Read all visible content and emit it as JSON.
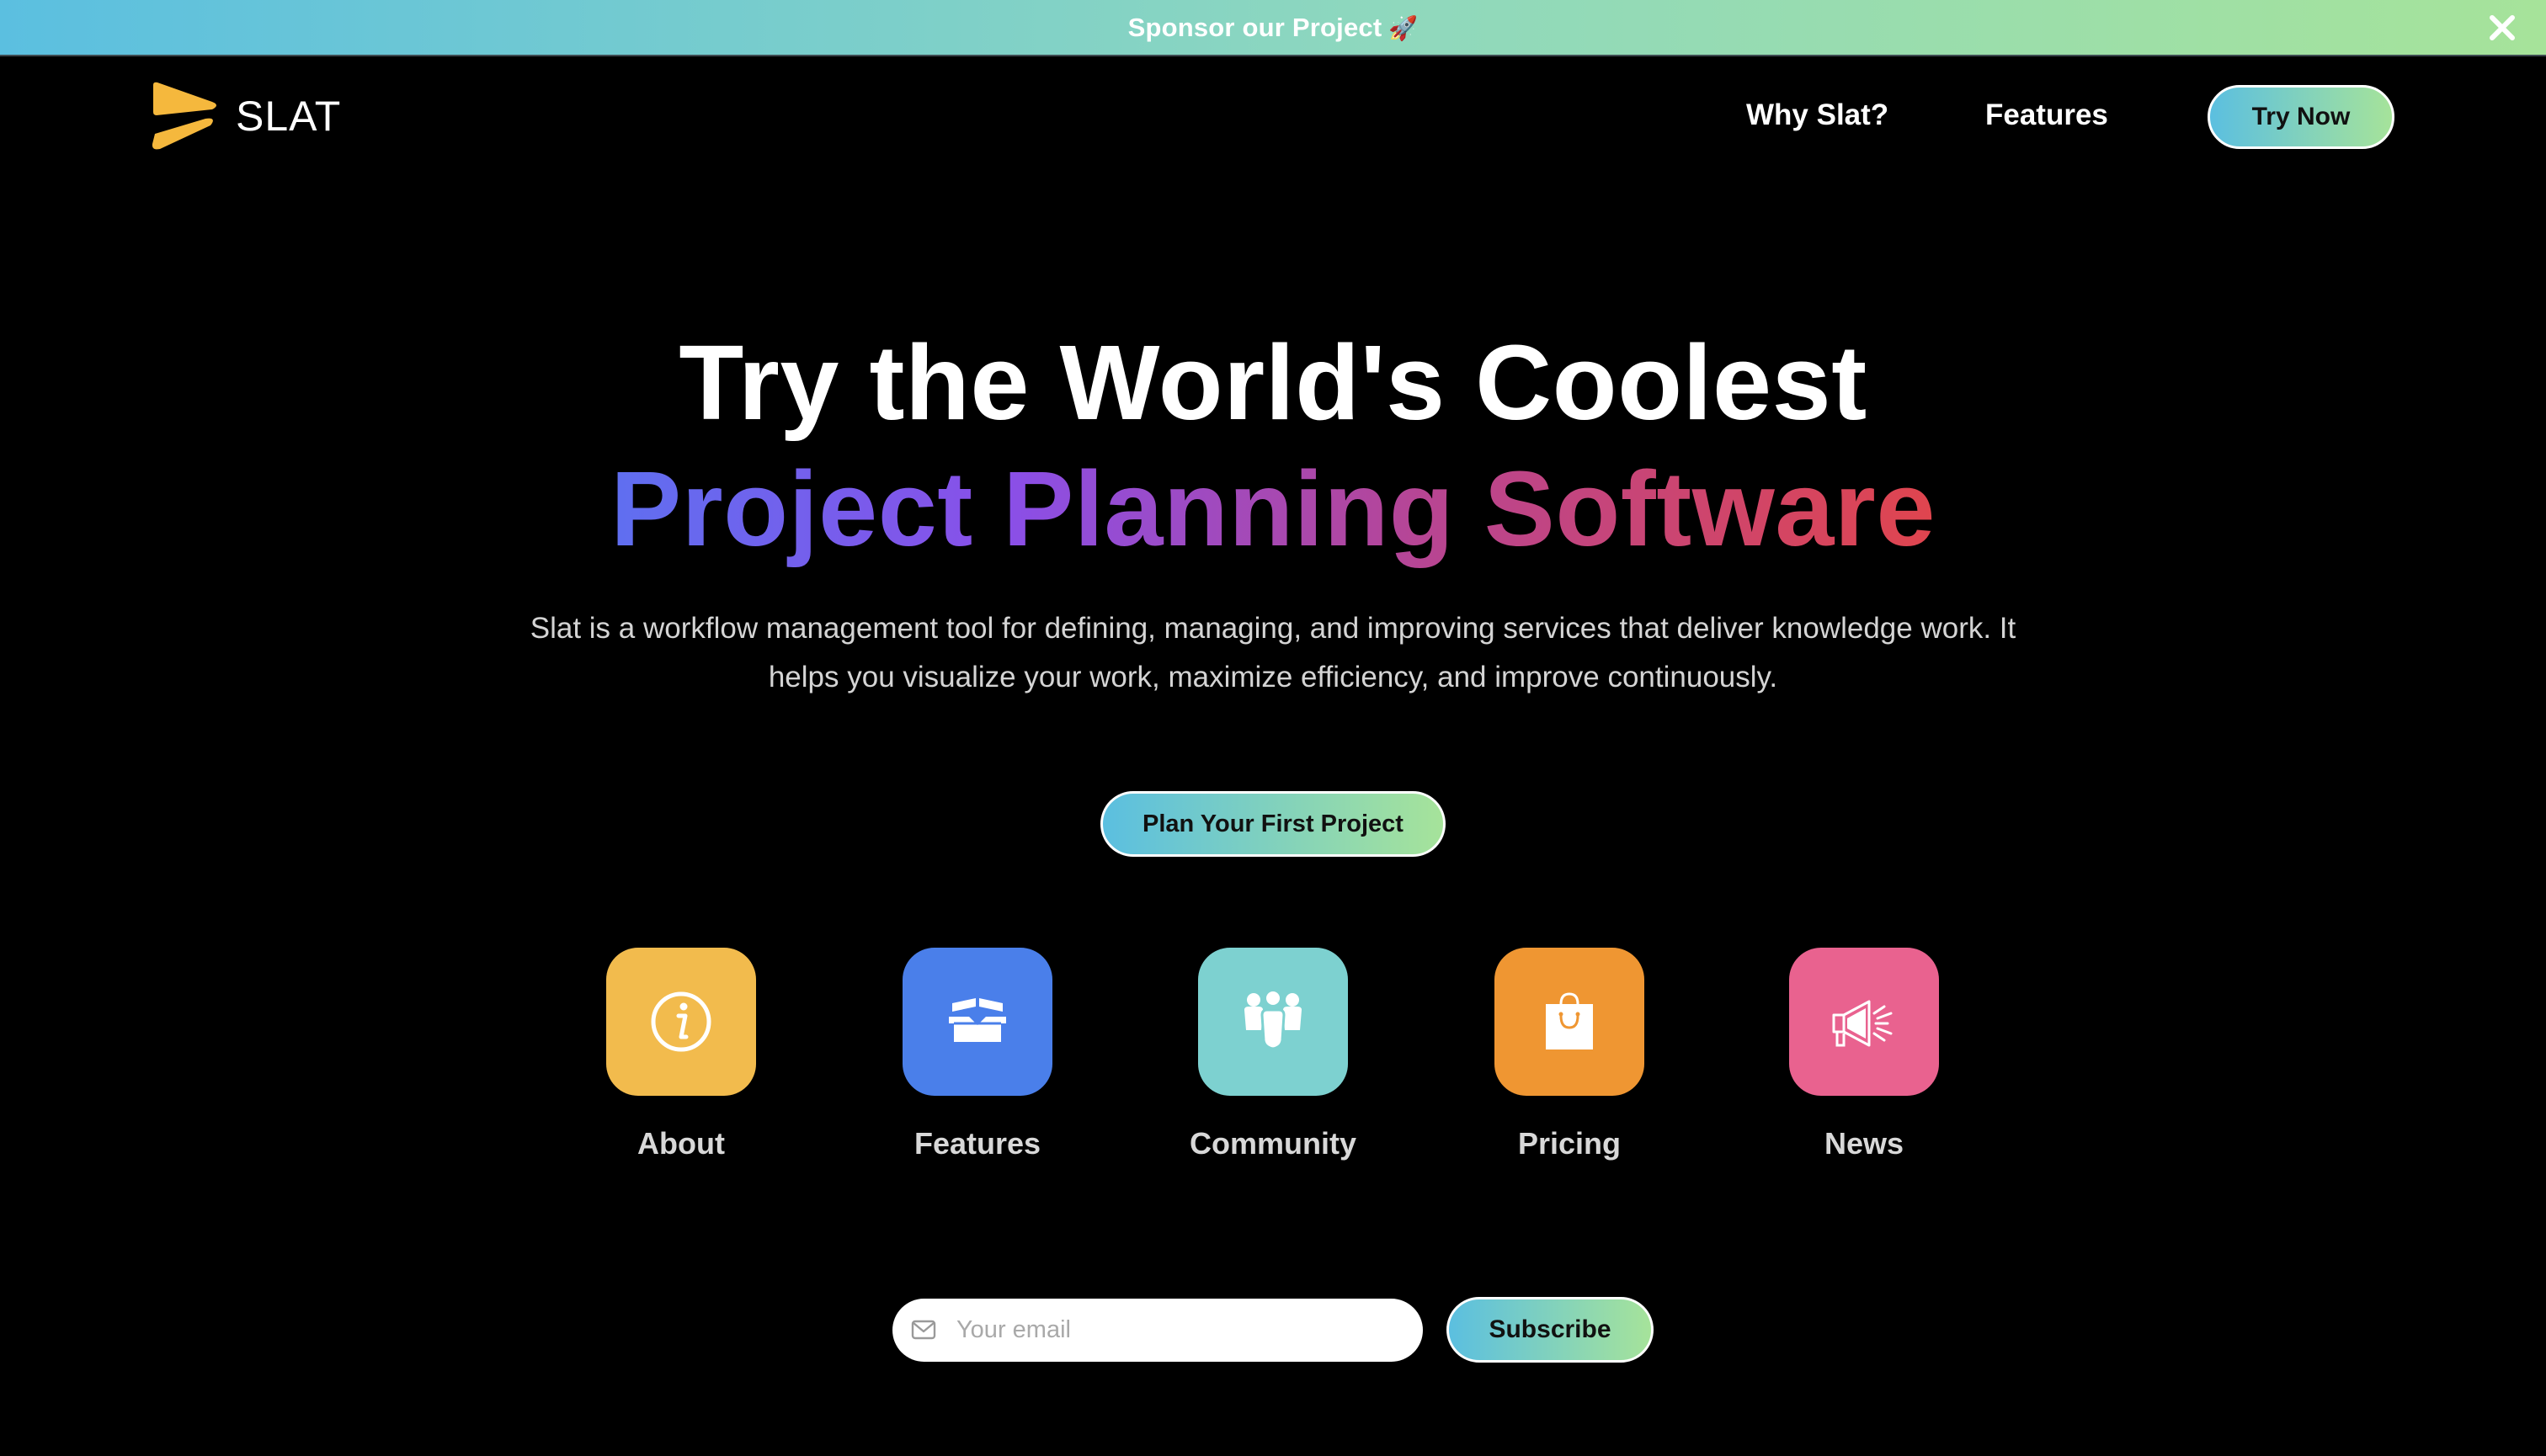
{
  "announcement": {
    "text": "Sponsor our Project",
    "emoji": "🚀",
    "close_icon": "close-icon"
  },
  "header": {
    "logo_text": "SLAT",
    "nav": [
      {
        "label": "Why Slat?"
      },
      {
        "label": "Features"
      }
    ],
    "cta_label": "Try Now"
  },
  "hero": {
    "title_line1": "Try the World's Coolest",
    "title_line2": "Project Planning Software",
    "description": "Slat is a workflow management tool for defining, managing, and improving services that deliver knowledge work. It helps you visualize your work, maximize efficiency, and improve continuously.",
    "cta_label": "Plan Your First Project"
  },
  "categories": [
    {
      "label": "About",
      "icon": "info-icon",
      "color": "#f2bb4d"
    },
    {
      "label": "Features",
      "icon": "open-box-icon",
      "color": "#4a7fea"
    },
    {
      "label": "Community",
      "icon": "people-group-icon",
      "color": "#7dd1d0"
    },
    {
      "label": "Pricing",
      "icon": "shopping-bag-icon",
      "color": "#ef9632"
    },
    {
      "label": "News",
      "icon": "megaphone-icon",
      "color": "#e9628f"
    }
  ],
  "subscribe": {
    "placeholder": "Your email",
    "button_label": "Subscribe",
    "icon": "mail-icon"
  },
  "colors": {
    "brand_gradient_start": "#5bbfe0",
    "brand_gradient_end": "#a6e39a",
    "logo_yellow": "#f5b83d",
    "hero_gradient": [
      "#5f6ff0",
      "#8a4fe8",
      "#b84592",
      "#e0454e"
    ]
  }
}
